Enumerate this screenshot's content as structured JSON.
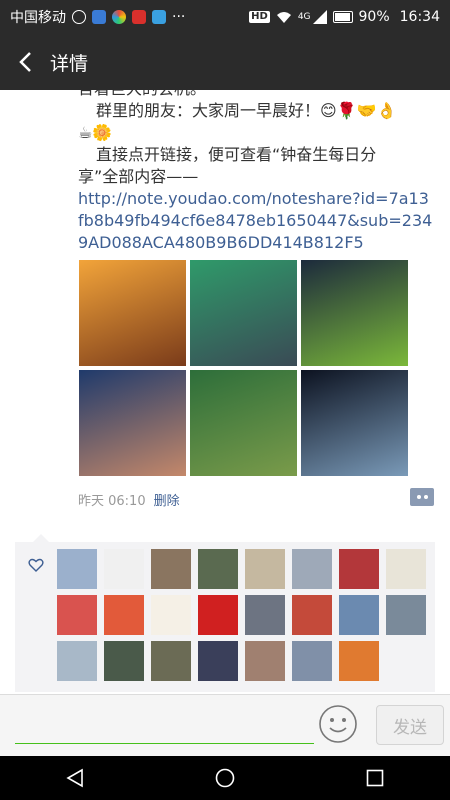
{
  "status": {
    "carrier": "中国移动",
    "hd": "HD",
    "signal": "4G",
    "battery": "90%",
    "time": "16:34",
    "more": "···"
  },
  "nav": {
    "title": "详情"
  },
  "post": {
    "line_top": "含着巨大的会机。",
    "line_greeting": "群里的朋友：大家周一早晨好！",
    "greeting_emojis": "😊🌹🤝👌",
    "second_emojis": "☕🌼",
    "line_open1": "直接点开链接，便可查看“钟奋生每日分",
    "line_open2": "享”全部内容——",
    "link": "http://note.youdao.com/noteshare?id=7a13fb8b49fb494cf6e8478eb1650447&sub=2349AD088ACA480B9B6DD414B812F5",
    "time": "昨天 06:10",
    "delete": "删除"
  },
  "photos": [
    {
      "name": "sunset-heron",
      "colors": [
        "#f2a43a",
        "#7a3b1a"
      ]
    },
    {
      "name": "aurora-mountain",
      "colors": [
        "#2f9a6a",
        "#3a4a55"
      ]
    },
    {
      "name": "grassland-yurt",
      "colors": [
        "#1c2a3c",
        "#7bb83a"
      ]
    },
    {
      "name": "crater-lake",
      "colors": [
        "#1f3a6b",
        "#c4886a"
      ]
    },
    {
      "name": "river-forest",
      "colors": [
        "#2d6e3a",
        "#7a9b4a"
      ]
    },
    {
      "name": "blue-sports-car",
      "colors": [
        "#0c1220",
        "#7a9ab8"
      ]
    }
  ],
  "likes": {
    "avatars": [
      {
        "name": "avatar-1",
        "color": "#9bb0cc"
      },
      {
        "name": "avatar-2",
        "color": "#f0f0f0"
      },
      {
        "name": "avatar-3",
        "color": "#8a7560"
      },
      {
        "name": "avatar-4",
        "color": "#5a6a50"
      },
      {
        "name": "avatar-5",
        "color": "#c5b8a0"
      },
      {
        "name": "avatar-6",
        "color": "#9ea9b8"
      },
      {
        "name": "avatar-7",
        "color": "#b3373a"
      },
      {
        "name": "avatar-8",
        "color": "#e8e4d8"
      },
      {
        "name": "avatar-9",
        "color": "#d9534f"
      },
      {
        "name": "avatar-10",
        "color": "#e25a3a"
      },
      {
        "name": "avatar-11",
        "color": "#f5f0e6"
      },
      {
        "name": "avatar-12",
        "color": "#d02020"
      },
      {
        "name": "avatar-13",
        "color": "#6d7482"
      },
      {
        "name": "avatar-14",
        "color": "#c44a3a"
      },
      {
        "name": "avatar-15",
        "color": "#6b8ab0"
      },
      {
        "name": "avatar-16",
        "color": "#7a8a9a"
      },
      {
        "name": "avatar-17",
        "color": "#a8b8c8"
      },
      {
        "name": "avatar-18",
        "color": "#4a5a4a"
      },
      {
        "name": "avatar-19",
        "color": "#6b6b55"
      },
      {
        "name": "avatar-20",
        "color": "#3a3f5a"
      },
      {
        "name": "avatar-21",
        "color": "#a08070"
      },
      {
        "name": "avatar-22",
        "color": "#8090a8"
      },
      {
        "name": "avatar-23",
        "color": "#e07a30"
      }
    ]
  },
  "input": {
    "placeholder": "",
    "send": "发送"
  },
  "colors": {
    "dark_bar": "#2b2b2b",
    "link": "#3e5f93",
    "green": "#45c01a"
  }
}
